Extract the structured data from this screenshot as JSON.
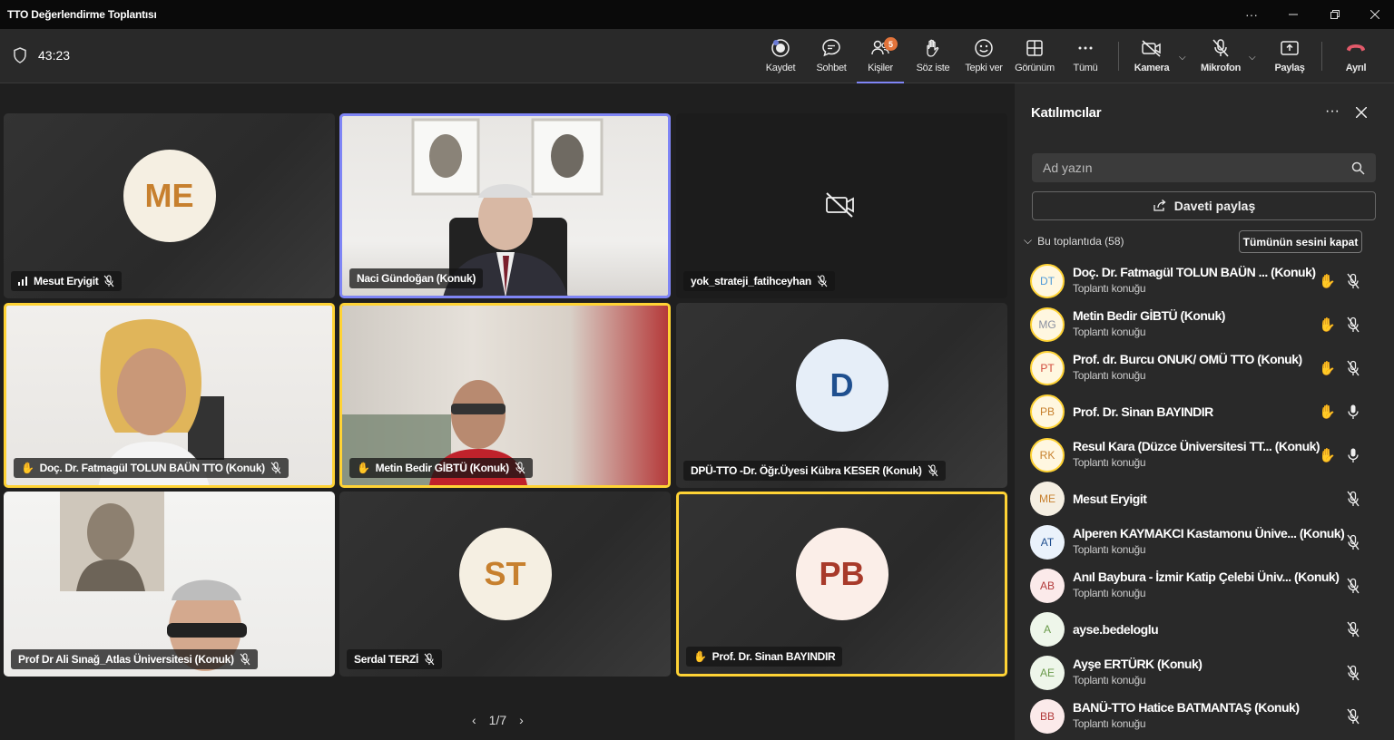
{
  "window": {
    "title": "TTO Değerlendirme Toplantısı"
  },
  "toolbar": {
    "timer": "43:23",
    "record": "Kaydet",
    "chat": "Sohbet",
    "people": "Kişiler",
    "people_badge": "5",
    "raise_hand": "Söz iste",
    "react": "Tepki ver",
    "view": "Görünüm",
    "more": "Tümü",
    "camera": "Kamera",
    "mic": "Mikrofon",
    "share": "Paylaş",
    "leave": "Ayrıl"
  },
  "colors": {
    "accent": "#7f85f5",
    "speaking": "#ffd335",
    "leave": "#e35a6a"
  },
  "tiles": [
    {
      "name": "Mesut Eryigit",
      "initials": "ME"
    },
    {
      "name": "Naci Gündoğan (Konuk)"
    },
    {
      "name": "yok_strateji_fatihceyhan"
    },
    {
      "name": "Doç. Dr. Fatmagül TOLUN BAÜN TTO (Konuk)"
    },
    {
      "name": "Metin Bedir GİBTÜ (Konuk)"
    },
    {
      "name": "DPÜ-TTO -Dr. Öğr.Üyesi Kübra KESER (Konuk)",
      "initials": "D"
    },
    {
      "name": "Prof Dr Ali Sınağ_Atlas Üniversitesi (Konuk)"
    },
    {
      "name": "Serdal TERZİ",
      "initials": "ST"
    },
    {
      "name": "Prof. Dr. Sinan BAYINDIR",
      "initials": "PB"
    }
  ],
  "pager": "1/7",
  "panel": {
    "title": "Katılımcılar",
    "search_placeholder": "Ad yazın",
    "invite": "Daveti paylaş",
    "section": "Bu toplantıda (58)",
    "mute_all": "Tümünün sesini kapat",
    "participants": [
      {
        "initials": "DT",
        "name": "Doç. Dr. Fatmagül TOLUN BAÜN ... (Konuk)",
        "role": "Toplantı konuğu"
      },
      {
        "initials": "MG",
        "name": "Metin Bedir GİBTÜ (Konuk)",
        "role": "Toplantı konuğu"
      },
      {
        "initials": "PT",
        "name": "Prof. dr. Burcu ONUK/ OMÜ TTO (Konuk)",
        "role": "Toplantı konuğu"
      },
      {
        "initials": "PB",
        "name": "Prof. Dr. Sinan BAYINDIR",
        "role": ""
      },
      {
        "initials": "RK",
        "name": "Resul Kara (Düzce Üniversitesi TT... (Konuk)",
        "role": "Toplantı konuğu"
      },
      {
        "initials": "ME",
        "name": "Mesut Eryigit",
        "role": ""
      },
      {
        "initials": "AT",
        "name": "Alperen KAYMAKCI Kastamonu Ünive... (Konuk)",
        "role": "Toplantı konuğu"
      },
      {
        "initials": "AB",
        "name": "Anıl Baybura - İzmir Katip Çelebi Üniv... (Konuk)",
        "role": "Toplantı konuğu"
      },
      {
        "initials": "A",
        "name": "ayse.bedeloglu",
        "role": ""
      },
      {
        "initials": "AE",
        "name": "Ayşe ERTÜRK (Konuk)",
        "role": "Toplantı konuğu"
      },
      {
        "initials": "BB",
        "name": "BANÜ-TTO Hatice BATMANTAŞ (Konuk)",
        "role": "Toplantı konuğu"
      }
    ]
  }
}
